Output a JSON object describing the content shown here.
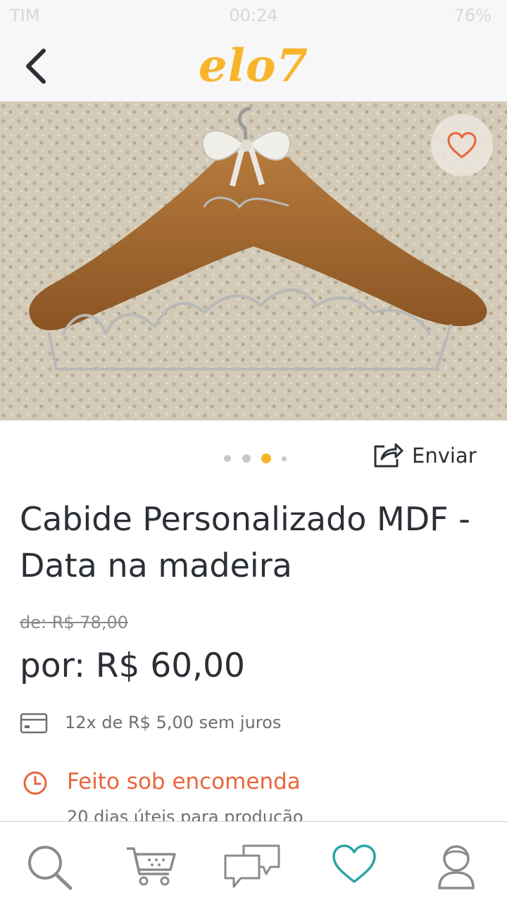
{
  "status_bar": {
    "carrier": "TIM",
    "time": "00:24",
    "battery": "76%"
  },
  "header": {
    "logo": "elo7",
    "back_icon": "chevron-left-icon"
  },
  "product": {
    "favorite_icon": "heart-outline-icon",
    "carousel": {
      "count": 4,
      "active_index": 2
    },
    "share_label": "Enviar",
    "title": "Cabide Personalizado MDF - Data na madeira",
    "old_price": "de: R$ 78,00",
    "price": "por: R$ 60,00",
    "installments": "12x de R$ 5,00 sem juros",
    "made_to_order": "Feito sob encomenda",
    "production_time": "20 dias úteis para produção"
  },
  "bottom_nav": [
    {
      "icon": "search-icon"
    },
    {
      "icon": "cart-icon"
    },
    {
      "icon": "chat-icon"
    },
    {
      "icon": "heart-icon",
      "active": true
    },
    {
      "icon": "profile-icon"
    }
  ],
  "colors": {
    "brand": "#f7b52c",
    "accent": "#e8663d",
    "active_nav": "#2ba5a5",
    "text": "#2b2f36",
    "muted": "#6b6f74"
  }
}
